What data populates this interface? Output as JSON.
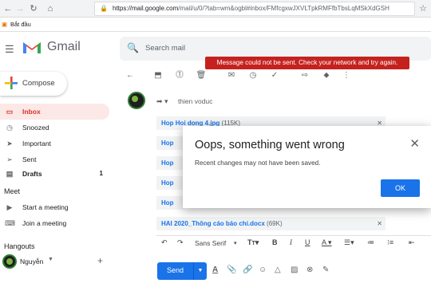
{
  "browser": {
    "url_host": "https://mail.google.com",
    "url_path": "/mail/u/0/?tab=wm&ogbl#inbox/FMfcgxwJXVLTpkRMFfbTbsLqMSkXdGSH",
    "bookmark": "Bắt đầu"
  },
  "gmail": {
    "logo_text": "Gmail",
    "search_placeholder": "Search mail",
    "toast": "Message could not be sent. Check your network and try again."
  },
  "sidebar": {
    "compose_label": "Compose",
    "items": [
      {
        "label": "Inbox",
        "count": ""
      },
      {
        "label": "Snoozed",
        "count": ""
      },
      {
        "label": "Important",
        "count": ""
      },
      {
        "label": "Sent",
        "count": ""
      },
      {
        "label": "Drafts",
        "count": "1"
      }
    ],
    "meet_title": "Meet",
    "meet_items": [
      "Start a meeting",
      "Join a meeting"
    ],
    "hangouts_title": "Hangouts",
    "hangouts_user": "Nguyễn"
  },
  "compose_window": {
    "from": "thien voduc",
    "attachments": [
      {
        "name": "Hop Hoi dong 4.jpg",
        "size": "(115K)"
      },
      {
        "name": "Hop",
        "size": ""
      },
      {
        "name": "Hop",
        "size": ""
      },
      {
        "name": "Hop",
        "size": ""
      },
      {
        "name": "Hop",
        "size": ""
      },
      {
        "name": "HAI 2020_Thông cáo báo chí.docx",
        "size": "(69K)"
      }
    ],
    "font_name": "Sans Serif",
    "send_label": "Send"
  },
  "dialog": {
    "title": "Oops, something went wrong",
    "message": "Recent changes may not have been saved.",
    "ok_label": "OK"
  },
  "colors": {
    "accent": "#1a73e8",
    "error": "#c5221f",
    "inbox_active_bg": "#fce8e6"
  }
}
